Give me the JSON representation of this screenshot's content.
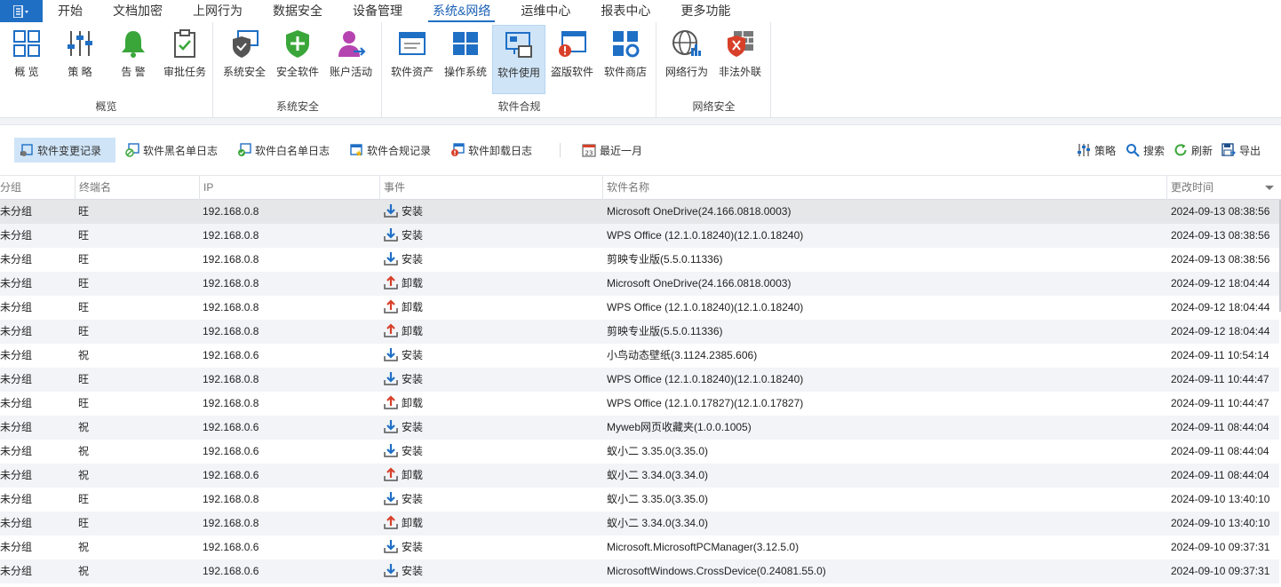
{
  "menu": {
    "app_icon": "ribbon-menu-icon",
    "items": [
      "开始",
      "文档加密",
      "上网行为",
      "数据安全",
      "设备管理",
      "系统&网络",
      "运维中心",
      "报表中心",
      "更多功能"
    ],
    "active": "系统&网络"
  },
  "ribbon": {
    "groups": [
      {
        "label": "概览",
        "buttons": [
          "概 览",
          "策 略",
          "告 警",
          "审批任务"
        ]
      },
      {
        "label": "系统安全",
        "buttons": [
          "系统安全",
          "安全软件",
          "账户活动"
        ]
      },
      {
        "label": "软件合规",
        "buttons": [
          "软件资产",
          "操作系统",
          "软件使用",
          "盗版软件",
          "软件商店"
        ]
      },
      {
        "label": "网络安全",
        "buttons": [
          "网络行为",
          "非法外联"
        ]
      }
    ],
    "active_button": "软件使用",
    "colors": {
      "blue": "#1f6fc5",
      "green": "#3aa63a",
      "red": "#d8402a",
      "purple": "#b544b0",
      "gray": "#666666"
    }
  },
  "toolbar": {
    "tabs": [
      "软件变更记录",
      "软件黑名单日志",
      "软件白名单日志",
      "软件合规记录",
      "软件卸载日志"
    ],
    "active_tab": "软件变更记录",
    "date_filter": "最近一月",
    "calendar_day": "23",
    "actions": [
      "策略",
      "搜索",
      "刷新",
      "导出"
    ]
  },
  "table": {
    "columns": [
      "分组",
      "终端名",
      "IP",
      "事件",
      "软件名称",
      "更改时间"
    ],
    "rows": [
      [
        "未分组",
        "旺",
        "192.168.0.8",
        "安装",
        "Microsoft OneDrive(24.166.0818.0003)",
        "2024-09-13 08:38:56"
      ],
      [
        "未分组",
        "旺",
        "192.168.0.8",
        "安装",
        "WPS Office (12.1.0.18240)(12.1.0.18240)",
        "2024-09-13 08:38:56"
      ],
      [
        "未分组",
        "旺",
        "192.168.0.8",
        "安装",
        "剪映专业版(5.5.0.11336)",
        "2024-09-13 08:38:56"
      ],
      [
        "未分组",
        "旺",
        "192.168.0.8",
        "卸载",
        "Microsoft OneDrive(24.166.0818.0003)",
        "2024-09-12 18:04:44"
      ],
      [
        "未分组",
        "旺",
        "192.168.0.8",
        "卸载",
        "WPS Office (12.1.0.18240)(12.1.0.18240)",
        "2024-09-12 18:04:44"
      ],
      [
        "未分组",
        "旺",
        "192.168.0.8",
        "卸载",
        "剪映专业版(5.5.0.11336)",
        "2024-09-12 18:04:44"
      ],
      [
        "未分组",
        "祝",
        "192.168.0.6",
        "安装",
        "小鸟动态壁纸(3.1124.2385.606)",
        "2024-09-11 10:54:14"
      ],
      [
        "未分组",
        "旺",
        "192.168.0.8",
        "安装",
        "WPS Office (12.1.0.18240)(12.1.0.18240)",
        "2024-09-11 10:44:47"
      ],
      [
        "未分组",
        "旺",
        "192.168.0.8",
        "卸载",
        "WPS Office (12.1.0.17827)(12.1.0.17827)",
        "2024-09-11 10:44:47"
      ],
      [
        "未分组",
        "祝",
        "192.168.0.6",
        "安装",
        "Myweb网页收藏夹(1.0.0.1005)",
        "2024-09-11 08:44:04"
      ],
      [
        "未分组",
        "祝",
        "192.168.0.6",
        "安装",
        "蚁小二 3.35.0(3.35.0)",
        "2024-09-11 08:44:04"
      ],
      [
        "未分组",
        "祝",
        "192.168.0.6",
        "卸载",
        "蚁小二 3.34.0(3.34.0)",
        "2024-09-11 08:44:04"
      ],
      [
        "未分组",
        "旺",
        "192.168.0.8",
        "安装",
        "蚁小二 3.35.0(3.35.0)",
        "2024-09-10 13:40:10"
      ],
      [
        "未分组",
        "旺",
        "192.168.0.8",
        "卸载",
        "蚁小二 3.34.0(3.34.0)",
        "2024-09-10 13:40:10"
      ],
      [
        "未分组",
        "祝",
        "192.168.0.6",
        "安装",
        "Microsoft.MicrosoftPCManager(3.12.5.0)",
        "2024-09-10 09:37:31"
      ],
      [
        "未分组",
        "祝",
        "192.168.0.6",
        "安装",
        "MicrosoftWindows.CrossDevice(0.24081.55.0)",
        "2024-09-10 09:37:31"
      ]
    ],
    "event_icons": {
      "安装": "install-arrow-icon",
      "卸载": "uninstall-arrow-icon"
    },
    "event_colors": {
      "安装": "#1f6fc5",
      "卸载": "#d8402a"
    }
  }
}
